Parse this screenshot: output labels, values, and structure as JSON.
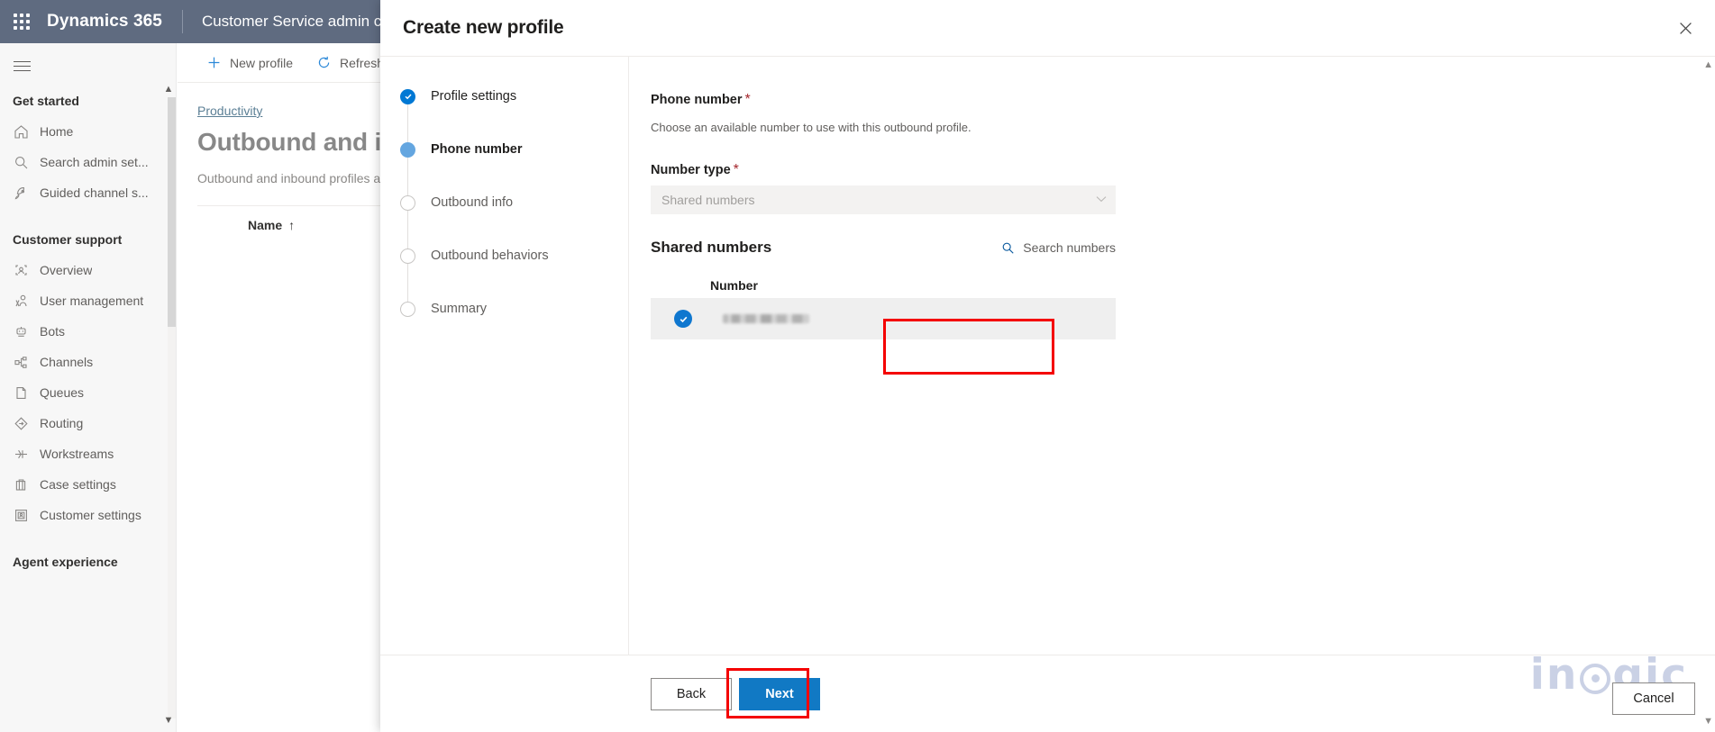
{
  "topbar": {
    "waffle_icon": "waffle-grid-icon",
    "brand": "Dynamics 365",
    "app_name": "Customer Service admin center",
    "hamburger_icon": "hamburger-icon"
  },
  "sidebar": {
    "groups": [
      {
        "title": "Get started",
        "items": [
          {
            "label": "Home",
            "icon": "home-icon"
          },
          {
            "label": "Search admin set...",
            "icon": "search-icon"
          },
          {
            "label": "Guided channel s...",
            "icon": "rocket-icon"
          }
        ]
      },
      {
        "title": "Customer support",
        "items": [
          {
            "label": "Overview",
            "icon": "overview-icon"
          },
          {
            "label": "User management",
            "icon": "people-icon"
          },
          {
            "label": "Bots",
            "icon": "bot-icon"
          },
          {
            "label": "Channels",
            "icon": "channels-icon"
          },
          {
            "label": "Queues",
            "icon": "queues-icon"
          },
          {
            "label": "Routing",
            "icon": "routing-icon"
          },
          {
            "label": "Workstreams",
            "icon": "workstreams-icon"
          },
          {
            "label": "Case settings",
            "icon": "case-icon"
          },
          {
            "label": "Customer settings",
            "icon": "customer-icon"
          }
        ]
      },
      {
        "title": "Agent experience",
        "items": []
      }
    ],
    "scroll_up_icon": "chevron-up-icon",
    "scroll_down_icon": "chevron-down-icon"
  },
  "page": {
    "commands": [
      {
        "label": "New profile",
        "icon": "plus-icon"
      },
      {
        "label": "Refresh",
        "icon": "refresh-icon"
      }
    ],
    "breadcrumb": "Productivity",
    "title": "Outbound and inb",
    "subtitle": "Outbound and inbound profiles a",
    "grid_column": "Name",
    "grid_sort_icon": "sort-ascending-icon"
  },
  "dialog": {
    "title": "Create new profile",
    "close_icon": "close-icon",
    "steps": [
      {
        "label": "Profile settings",
        "state": "done"
      },
      {
        "label": "Phone number",
        "state": "current"
      },
      {
        "label": "Outbound info",
        "state": "todo"
      },
      {
        "label": "Outbound behaviors",
        "state": "todo"
      },
      {
        "label": "Summary",
        "state": "todo"
      }
    ],
    "form": {
      "section_label": "Phone number",
      "section_required": "*",
      "help_text": "Choose an available number to use with this outbound profile.",
      "number_type_label": "Number type",
      "number_type_required": "*",
      "number_type_value": "Shared numbers",
      "number_type_chevron_icon": "chevron-down-icon",
      "shared_numbers_heading": "Shared numbers",
      "search_link_label": "Search numbers",
      "search_link_icon": "search-icon",
      "table": {
        "column_header": "Number",
        "rows": [
          {
            "selected": true,
            "value": "",
            "redacted": true,
            "check_icon": "check-circle-icon"
          }
        ]
      }
    },
    "footer": {
      "back_label": "Back",
      "next_label": "Next",
      "cancel_label": "Cancel"
    }
  },
  "watermark": {
    "text_before": "in",
    "text_after": "gic"
  },
  "highlights": {
    "accent_red": "#f40000",
    "primary_blue": "#1179c4"
  }
}
